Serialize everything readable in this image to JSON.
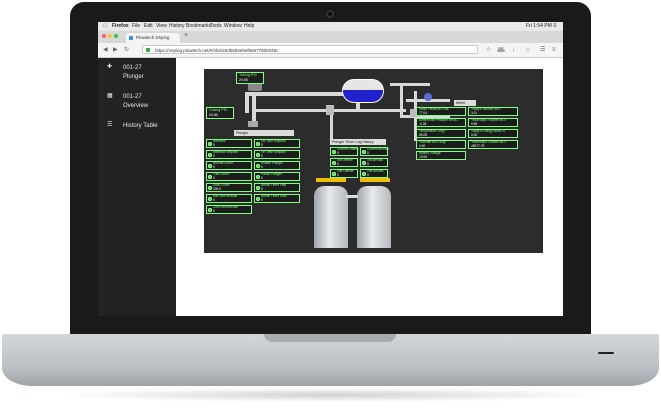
{
  "menubar": {
    "apple": "",
    "items": [
      "Firefox",
      "File",
      "Edit",
      "View",
      "History",
      "Bookmarks",
      "Tools",
      "Window",
      "Help"
    ],
    "clock": "Fri 1:54 PM"
  },
  "browser": {
    "tab_title": "Plowtech Dsping",
    "tab_add": "+",
    "url": "https://onping.plowtech.net/#/nbe/263b6b6ebef66677600349c",
    "zoom": "90%"
  },
  "sidebar": {
    "items": [
      {
        "label_line1": "001-27",
        "label_line2": "Plunger",
        "icon": "plunger-icon"
      },
      {
        "label_line1": "001-27",
        "label_line2": "Overview",
        "icon": "grid-icon"
      },
      {
        "label_line1": "History Table",
        "label_line2": "",
        "icon": "list-icon"
      }
    ]
  },
  "hmi": {
    "tubing_psi": {
      "label": "Tubing PSI",
      "value": "24.80"
    },
    "casing_psi": {
      "label": "Casing PSI",
      "value": "24.80"
    },
    "plunger_title": "Plunger",
    "meter_title": "Meter",
    "plunger_cells": [
      {
        "label": "Afterflow",
        "value": "0"
      },
      {
        "label": "Off Time Setpoint",
        "value": "0"
      },
      {
        "label": "Afterflow Setpoint",
        "value": "0"
      },
      {
        "label": "On Time Setpoint",
        "value": "0"
      },
      {
        "label": "Normal Count",
        "value": "0"
      },
      {
        "label": "Enable Plunger",
        "value": "0"
      },
      {
        "label": "Fast Count",
        "value": "0"
      },
      {
        "label": "Pause Plunger",
        "value": "0"
      },
      {
        "label": "Slow Count",
        "value": "226.0"
      },
      {
        "label": "Arrival Timer Fast",
        "value": "0"
      },
      {
        "label": "Max Non Arrivals",
        "value": "0"
      },
      {
        "label": "Arrival Timer Slow",
        "value": "0"
      },
      {
        "label": "Cont Non Arrivals",
        "value": "0"
      }
    ],
    "log_title": "Plunger Timer Log History",
    "log_cells": [
      {
        "label": "Current Offtime",
        "value": "0"
      },
      {
        "label": "Current Arrivals",
        "value": "0"
      },
      {
        "label": "3rd Offtime",
        "value": "0"
      },
      {
        "label": "3rd Arrivals",
        "value": "0"
      },
      {
        "label": "2nd Offtime",
        "value": "0"
      },
      {
        "label": "2nd Arrivals",
        "value": "0"
      }
    ],
    "meter_cells": [
      {
        "label": "Static Pressure PSIa",
        "value": "77.04"
      },
      {
        "label": "Today's Volume MCF",
        "value": "3.01"
      },
      {
        "label": "Differential Pressure InH2O",
        "value": "-0.28"
      },
      {
        "label": "Yesterday's Volume MCF",
        "value": "0.69"
      },
      {
        "label": "Temperature Deg F",
        "value": "65.08"
      },
      {
        "label": "Today's Energy MMBTU",
        "value": "0.00"
      },
      {
        "label": "Flowrate MCF/Day",
        "value": "0.00"
      },
      {
        "label": "Yesterday's Volume MCF",
        "value": "49677.79"
      },
      {
        "label": "Battery Voltage",
        "value": "13.06"
      }
    ]
  },
  "colors": {
    "hmi_green": "#7fff7f",
    "hmi_bg": "#2c2c2c",
    "sidebar_bg": "#222222",
    "tank_blue": "#2222cc",
    "tank_level_bar": "#f0c000"
  }
}
